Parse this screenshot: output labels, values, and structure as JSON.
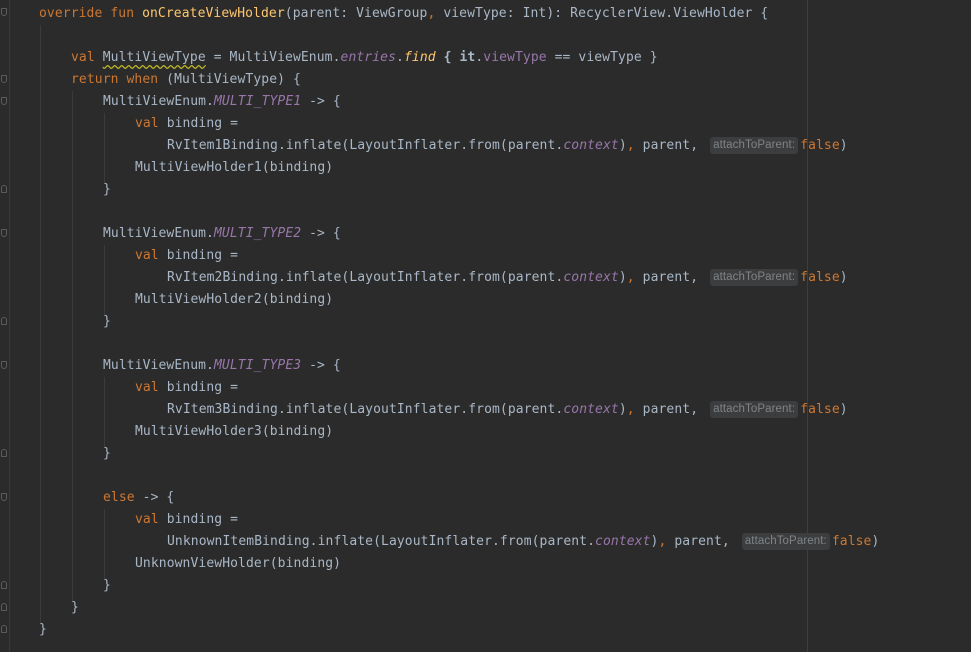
{
  "editor": {
    "language": "Kotlin",
    "colors": {
      "background": "#2b2b2b",
      "text": "#a9b7c6",
      "keyword": "#cc7832",
      "function": "#ffc66d",
      "property": "#9876aa",
      "inlay_hint_bg": "#3b3d3f",
      "inlay_hint_text": "#808385"
    },
    "lines": {
      "l1": {
        "override": "override",
        "fun": "fun",
        "name": "onCreateViewHolder",
        "params_a": "(parent: ViewGroup",
        "comma": ",",
        "params_b": " viewType: Int): RecyclerView.ViewHolder {"
      },
      "l3": {
        "val": "val",
        "var_name": "MultiViewType",
        "assign": " = MultiViewEnum.",
        "entries": "entries",
        "dot": ".",
        "find": "find",
        "brace": " { ",
        "it": "it",
        "dot2": ".",
        "viewtype_prop": "viewType",
        "rest": " == viewType }"
      },
      "l4": {
        "return": "return",
        "when": "when",
        "rest": " (MultiViewType) {"
      },
      "b1": {
        "enum_prefix": "MultiViewEnum.",
        "enum_const": "MULTI_TYPE1",
        "arrow": " -> {",
        "val": "val",
        "binding": " binding =",
        "inflate_a": "RvItem1Binding.inflate(LayoutInflater.from(parent.",
        "context": "context",
        "paren": ")",
        "comma": ",",
        "parent": " parent,",
        "hint": "attachToParent:",
        "false": "false",
        "close": ")",
        "holder": "MultiViewHolder1(binding)",
        "end": "}"
      },
      "b2": {
        "enum_prefix": "MultiViewEnum.",
        "enum_const": "MULTI_TYPE2",
        "arrow": " -> {",
        "val": "val",
        "binding": " binding =",
        "inflate_a": "RvItem2Binding.inflate(LayoutInflater.from(parent.",
        "context": "context",
        "paren": ")",
        "comma": ",",
        "parent": " parent,",
        "hint": "attachToParent:",
        "false": "false",
        "close": ")",
        "holder": "MultiViewHolder2(binding)",
        "end": "}"
      },
      "b3": {
        "enum_prefix": "MultiViewEnum.",
        "enum_const": "MULTI_TYPE3",
        "arrow": " -> {",
        "val": "val",
        "binding": " binding =",
        "inflate_a": "RvItem3Binding.inflate(LayoutInflater.from(parent.",
        "context": "context",
        "paren": ")",
        "comma": ",",
        "parent": " parent,",
        "hint": "attachToParent:",
        "false": "false",
        "close": ")",
        "holder": "MultiViewHolder3(binding)",
        "end": "}"
      },
      "b4": {
        "else": "else",
        "arrow": " -> {",
        "val": "val",
        "binding": " binding =",
        "inflate_a": "UnknownItemBinding.inflate(LayoutInflater.from(parent.",
        "context": "context",
        "paren": ")",
        "comma": ",",
        "parent": " parent,",
        "hint": "attachToParent:",
        "false": "false",
        "close": ")",
        "holder": "UnknownViewHolder(binding)",
        "end": "}"
      },
      "when_end": "}",
      "fun_end": "}"
    }
  }
}
